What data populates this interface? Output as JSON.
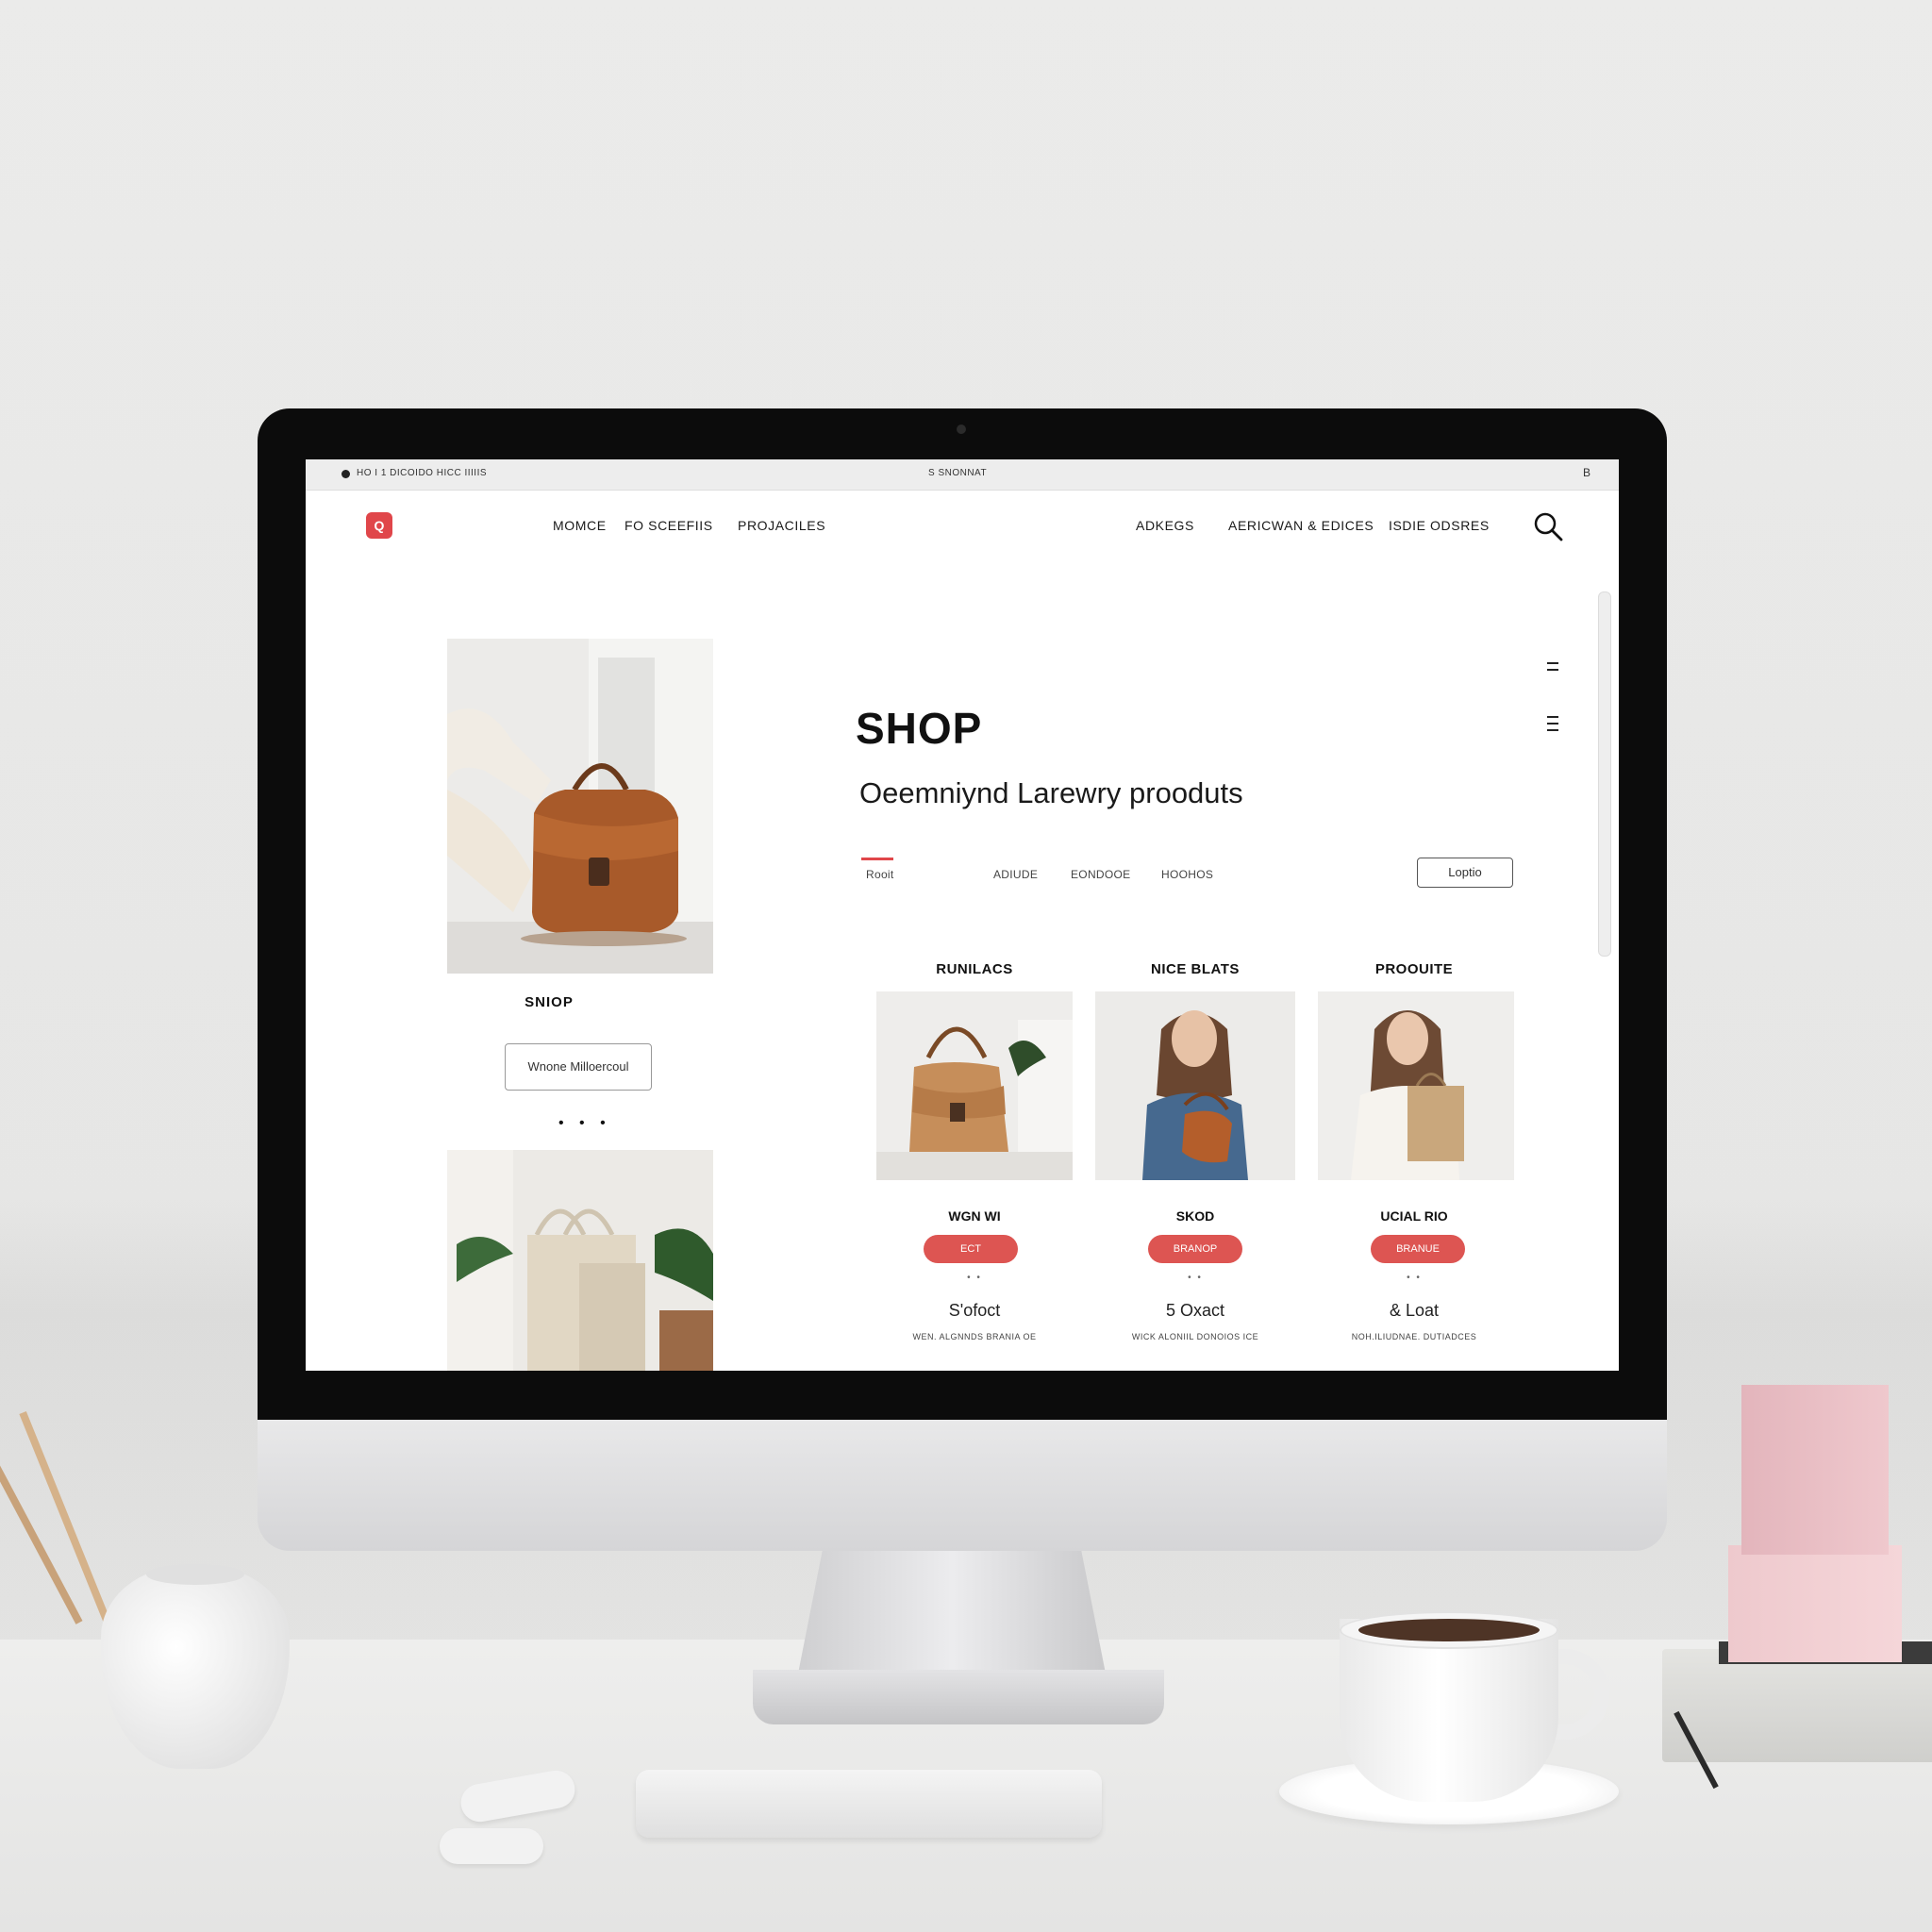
{
  "window": {
    "status_left": "HO I 1 DICOIDO HICC IIIIIS",
    "status_center": "S SNONNAT",
    "status_right": "B"
  },
  "nav": {
    "logo_glyph": "Q",
    "items": [
      "MOMCE",
      "FO SCEEFIIS",
      "PROJACILES",
      "ADKEGS",
      "AERICWAN & EDICES",
      "ISDIE ODSRES"
    ]
  },
  "left_column": {
    "caption": "SNIOP",
    "button_label": "Wnone Milloercoul",
    "dots": "• • •"
  },
  "hero": {
    "title": "SHOP",
    "subtitle": "Oeemniynd Larewry prooduts"
  },
  "filter_tabs": [
    "Rooit",
    "ADIUDE",
    "EONDOOE",
    "HOOHOS"
  ],
  "login_button": "Loptio",
  "products": [
    {
      "title": "RUNILACS",
      "name": "WGN WI",
      "button": "ECT",
      "rating": "• •",
      "price": "S'ofoct",
      "desc": "WEN. ALGNNDS BRANIA OE"
    },
    {
      "title": "NICE BLATS",
      "name": "SKOD",
      "button": "BRANOP",
      "rating": "• •",
      "price": "5 Oxact",
      "desc": "WICK ALONIIL DONOIOS ICE"
    },
    {
      "title": "PROOUITE",
      "name": "UCIAL RIO",
      "button": "BRANUE",
      "rating": "• •",
      "price": "& Loat",
      "desc": "NOH.ILIUDNAE. DUTIADCES"
    }
  ],
  "colors": {
    "accent": "#dd5552",
    "logo": "#e0464a",
    "text": "#111111"
  }
}
